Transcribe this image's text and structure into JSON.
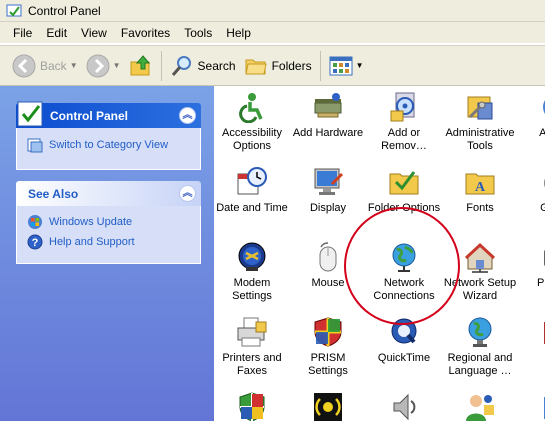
{
  "window": {
    "title": "Control Panel"
  },
  "menubar": {
    "items": [
      "File",
      "Edit",
      "View",
      "Favorites",
      "Tools",
      "Help"
    ]
  },
  "toolbar": {
    "back_label": "Back",
    "search_label": "Search",
    "folders_label": "Folders"
  },
  "left_pane": {
    "control_panel": {
      "header": "Control Panel",
      "link": "Switch to Category View"
    },
    "see_also": {
      "header": "See Also",
      "links": [
        "Windows Update",
        "Help and Support"
      ]
    }
  },
  "items": [
    {
      "label": "Accessibility Options",
      "icon": "accessibility-icon"
    },
    {
      "label": "Add Hardware",
      "icon": "add-hardware-icon"
    },
    {
      "label": "Add or Remov…",
      "icon": "add-remove-programs-icon"
    },
    {
      "label": "Administrative Tools",
      "icon": "administrative-tools-icon"
    },
    {
      "label": "Aut Up",
      "icon": "automatic-updates-icon"
    },
    {
      "label": "Date and Time",
      "icon": "date-time-icon"
    },
    {
      "label": "Display",
      "icon": "display-icon"
    },
    {
      "label": "Folder Options",
      "icon": "folder-options-icon"
    },
    {
      "label": "Fonts",
      "icon": "fonts-icon"
    },
    {
      "label": "G Con",
      "icon": "game-controllers-icon"
    },
    {
      "label": "Modem Settings",
      "icon": "modem-icon"
    },
    {
      "label": "Mouse",
      "icon": "mouse-icon"
    },
    {
      "label": "Network Connections",
      "icon": "network-connections-icon"
    },
    {
      "label": "Network Setup Wizard",
      "icon": "network-setup-wizard-icon"
    },
    {
      "label": "Pho Mo",
      "icon": "phone-modem-icon"
    },
    {
      "label": "Printers and Faxes",
      "icon": "printers-faxes-icon"
    },
    {
      "label": "PRISM Settings",
      "icon": "prism-settings-icon"
    },
    {
      "label": "QuickTime",
      "icon": "quicktime-icon"
    },
    {
      "label": "Regional and Language …",
      "icon": "regional-language-icon"
    },
    {
      "label": "R H",
      "icon": "r-icon"
    }
  ],
  "colors": {
    "highlight": "#d4001a",
    "link": "#215dc6",
    "pane": "#6d8fe0"
  }
}
